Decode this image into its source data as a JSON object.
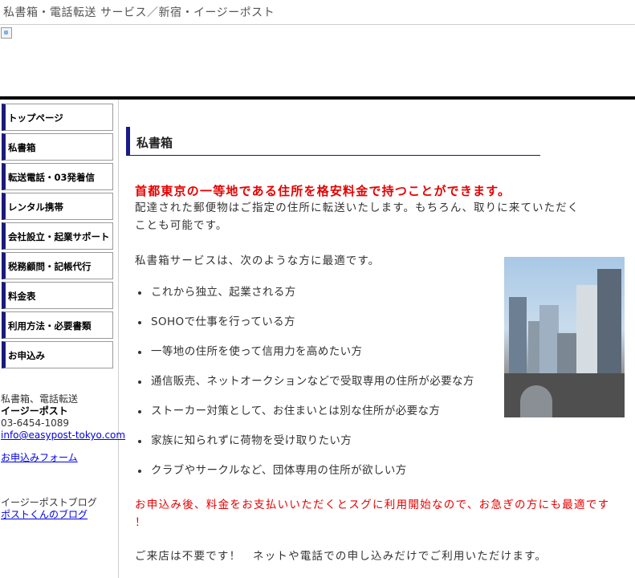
{
  "header": {
    "site_title": "私書箱・電話転送 サービス／新宿・イージーポスト"
  },
  "nav": {
    "items": [
      "トップページ",
      "私書箱",
      "転送電話・03発着信",
      "レンタル携帯",
      "会社設立・起業サポート",
      "税務顧問・記帳代行",
      "料金表",
      "利用方法・必要書類",
      "お申込み"
    ]
  },
  "sidebar": {
    "company_desc": "私書箱、電話転送",
    "company_name": "イージーポスト",
    "phone": "03-6454-1089",
    "email": "info@easypost-tokyo.com",
    "form_link": "お申込みフォーム",
    "blog_label": "イージーポストブログ",
    "blog_link": "ポストくんのブログ"
  },
  "main": {
    "section_title": "私書箱",
    "lead": "首都東京の一等地である住所を格安料金で持つことができます。",
    "intro_line1": "配達された郵便物はご指定の住所に転送いたします。もちろん、取りに来ていただく",
    "intro_line2": "ことも可能です。",
    "suitable_for": "私書箱サービスは、次のような方に最適です。",
    "bullets": [
      "これから独立、起業される方",
      "SOHOで仕事を行っている方",
      "一等地の住所を使って信用力を高めたい方",
      "通信販売、ネットオークションなどで受取専用の住所が必要な方",
      "ストーカー対策として、お住まいとは別な住所が必要な方",
      "家族に知られずに荷物を受け取りたい方",
      "クラブやサークルなど、団体専用の住所が欲しい方"
    ],
    "notice_line1": "お申込み後、料金をお支払いいただくとスグに利用開始なので、お急ぎの方にも最適です",
    "notice_line2": "！",
    "closing": "ご来店は不要です！　ネットや電話での申し込みだけでご利用いただけます。"
  },
  "colors": {
    "nav_accent": "#1a1a7a",
    "lead_red": "#e60000",
    "link_blue": "#0000ee",
    "header_bar": "#000000"
  }
}
